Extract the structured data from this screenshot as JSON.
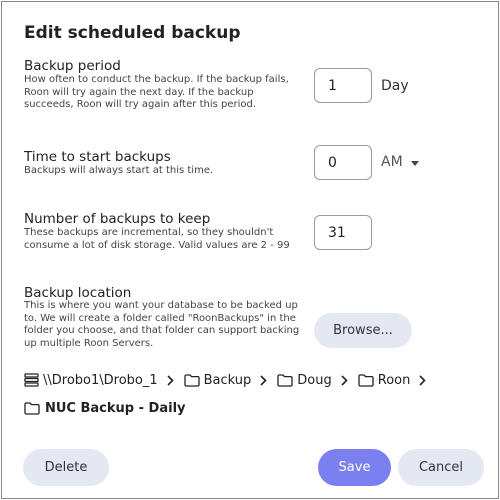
{
  "dialog": {
    "title": "Edit scheduled backup"
  },
  "period": {
    "title": "Backup period",
    "description": "How often to conduct the backup. If the backup fails, Roon will try again the next day. If the backup succeeds, Roon will try again after this period.",
    "value": "1",
    "unit": "Day"
  },
  "start_time": {
    "title": "Time to start backups",
    "description": "Backups will always start at this time.",
    "value": "0",
    "ampm": "AM"
  },
  "keep": {
    "title": "Number of backups to keep",
    "description": "These backups are incremental, so they shouldn't consume a lot of disk storage. Valid values are 2 - 99",
    "value": "31"
  },
  "location": {
    "title": "Backup location",
    "description": "This is where you want your database to be backed up to. We will create a folder called \"RoonBackups\" in the folder you choose, and that folder can support backing up multiple Roon Servers.",
    "browse_label": "Browse...",
    "path": {
      "root": "\\\\Drobo1\\Drobo_1",
      "folders": [
        "Backup",
        "Doug",
        "Roon"
      ],
      "final": "NUC Backup - Daily"
    }
  },
  "actions": {
    "delete_label": "Delete",
    "save_label": "Save",
    "cancel_label": "Cancel"
  },
  "colors": {
    "primary": "#7b80f0",
    "secondary_button": "#e4e8f3",
    "border": "#8a8a8a"
  },
  "icons": {
    "root": "server-icon",
    "folder": "folder-icon",
    "separator": "chevron-right-icon",
    "dropdown": "caret-down-icon"
  }
}
